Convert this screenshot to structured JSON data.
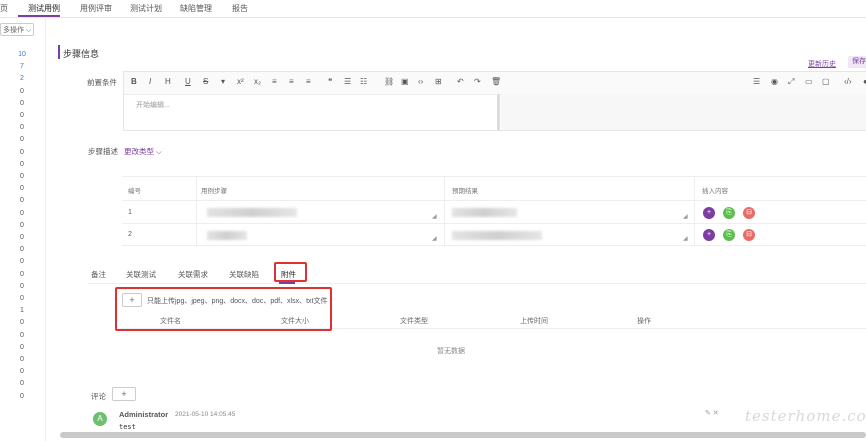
{
  "topnav": {
    "tabs": [
      "页",
      "测试用例",
      "用例评审",
      "测试计划",
      "缺陷管理",
      "报告"
    ],
    "active_index": 1
  },
  "left": {
    "ops_button": "多操作",
    "numbers": [
      "10",
      "7",
      "2",
      "0",
      "0",
      "0",
      "0",
      "0",
      "0",
      "0",
      "0",
      "0",
      "0",
      "0",
      "0",
      "0",
      "0",
      "0",
      "0",
      "0",
      "0",
      "1",
      "0",
      "0",
      "0",
      "0",
      "0",
      "0",
      "0"
    ]
  },
  "section": {
    "title": "步骤信息",
    "right_link": "更新历史",
    "right_button": "保存"
  },
  "precondition": {
    "label": "前置条件",
    "placeholder": "开始编辑..."
  },
  "steps": {
    "label": "步骤描述",
    "mode": "更改类型",
    "headers": {
      "no": "编号",
      "desc": "用例步骤",
      "expected": "预期结果",
      "insert": "插入内容"
    },
    "rows": [
      {
        "no": "1"
      },
      {
        "no": "2"
      }
    ]
  },
  "lower_tabs": [
    "备注",
    "关联测试",
    "关联需求",
    "关联缺陷",
    "附件"
  ],
  "attachments": {
    "upload_symbol": "+",
    "hint": "只能上传jpg、jpeg、png、docx、doc、pdf、xlsx、txt文件",
    "headers": [
      "文件名",
      "文件大小",
      "文件类型",
      "上传时间",
      "操作"
    ],
    "empty_text": "暂无数据"
  },
  "comments": {
    "label": "评论",
    "add_symbol": "+",
    "avatar_letter": "A",
    "user": "Administrator",
    "time": "2021-05-10 14:05:45",
    "text": "test",
    "icons": "✎ ✕"
  },
  "watermark": "testerhome.com",
  "colors": {
    "accent": "#7a3fa0",
    "highlight": "#e03131"
  }
}
